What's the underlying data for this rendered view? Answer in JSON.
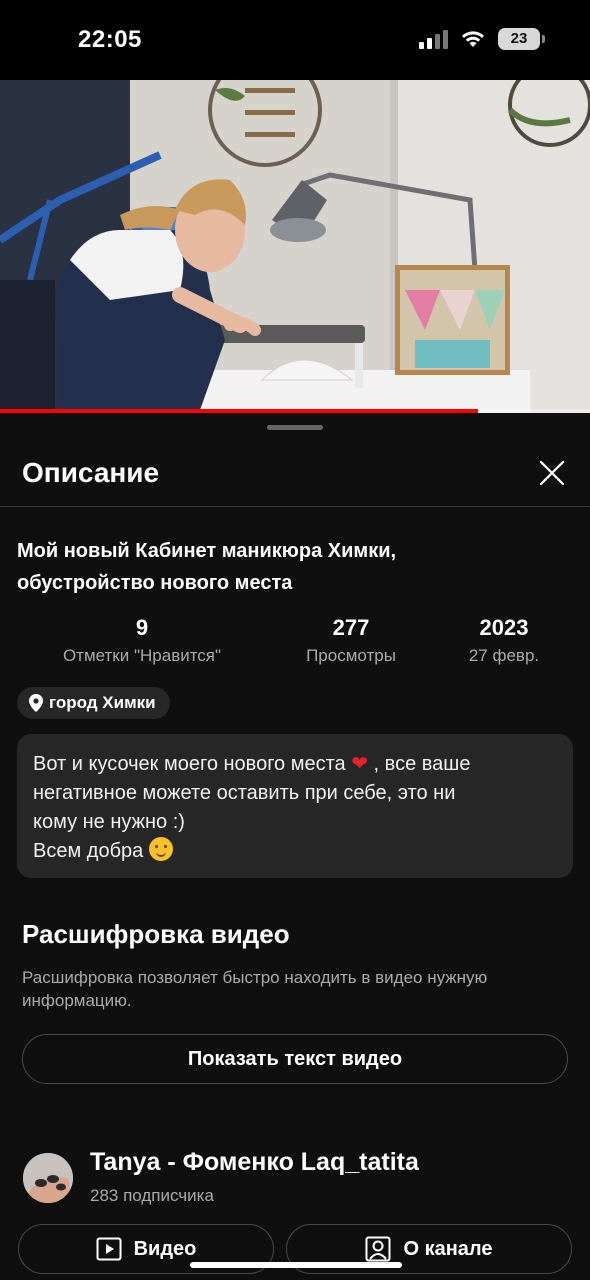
{
  "status_bar": {
    "time": "22:05",
    "battery": "23",
    "icons": [
      "cellular-signal-icon",
      "wifi-icon",
      "battery-icon"
    ]
  },
  "video": {
    "progress_fraction": 0.81,
    "progress_color": "#ff0000"
  },
  "sheet": {
    "title": "Описание",
    "close_icon": "close-icon"
  },
  "video_info": {
    "title_line1": "Мой новый Кабинет маникюра Химки,",
    "title_line2": "обустройство нового места",
    "stats": [
      {
        "value": "9",
        "label": "Отметки \"Нравится\""
      },
      {
        "value": "277",
        "label": "Просмотры"
      },
      {
        "value": "2023",
        "label": "27 февр."
      }
    ],
    "location": "город Химки",
    "location_icon": "location-pin-icon"
  },
  "description": {
    "line1_before": "Вот и кусочек моего нового места ",
    "line1_emoji": "❤",
    "line1_after": " , все ваше",
    "line2": "негативное можете оставить при себе, это ни",
    "line3": "кому не нужно :)",
    "line4": "Всем добра ",
    "line4_emoji": "hugging-face-emoji"
  },
  "transcript": {
    "title": "Расшифровка видео",
    "description": "Расшифровка позволяет быстро находить в видео нужную информацию.",
    "button": "Показать текст видео"
  },
  "channel": {
    "name": "Tanya - Фоменко Laq_tatita",
    "subscribers": "283 подписчика",
    "video_button": "Видео",
    "video_icon": "play-square-icon",
    "about_button": "О канале",
    "about_icon": "person-square-icon"
  }
}
